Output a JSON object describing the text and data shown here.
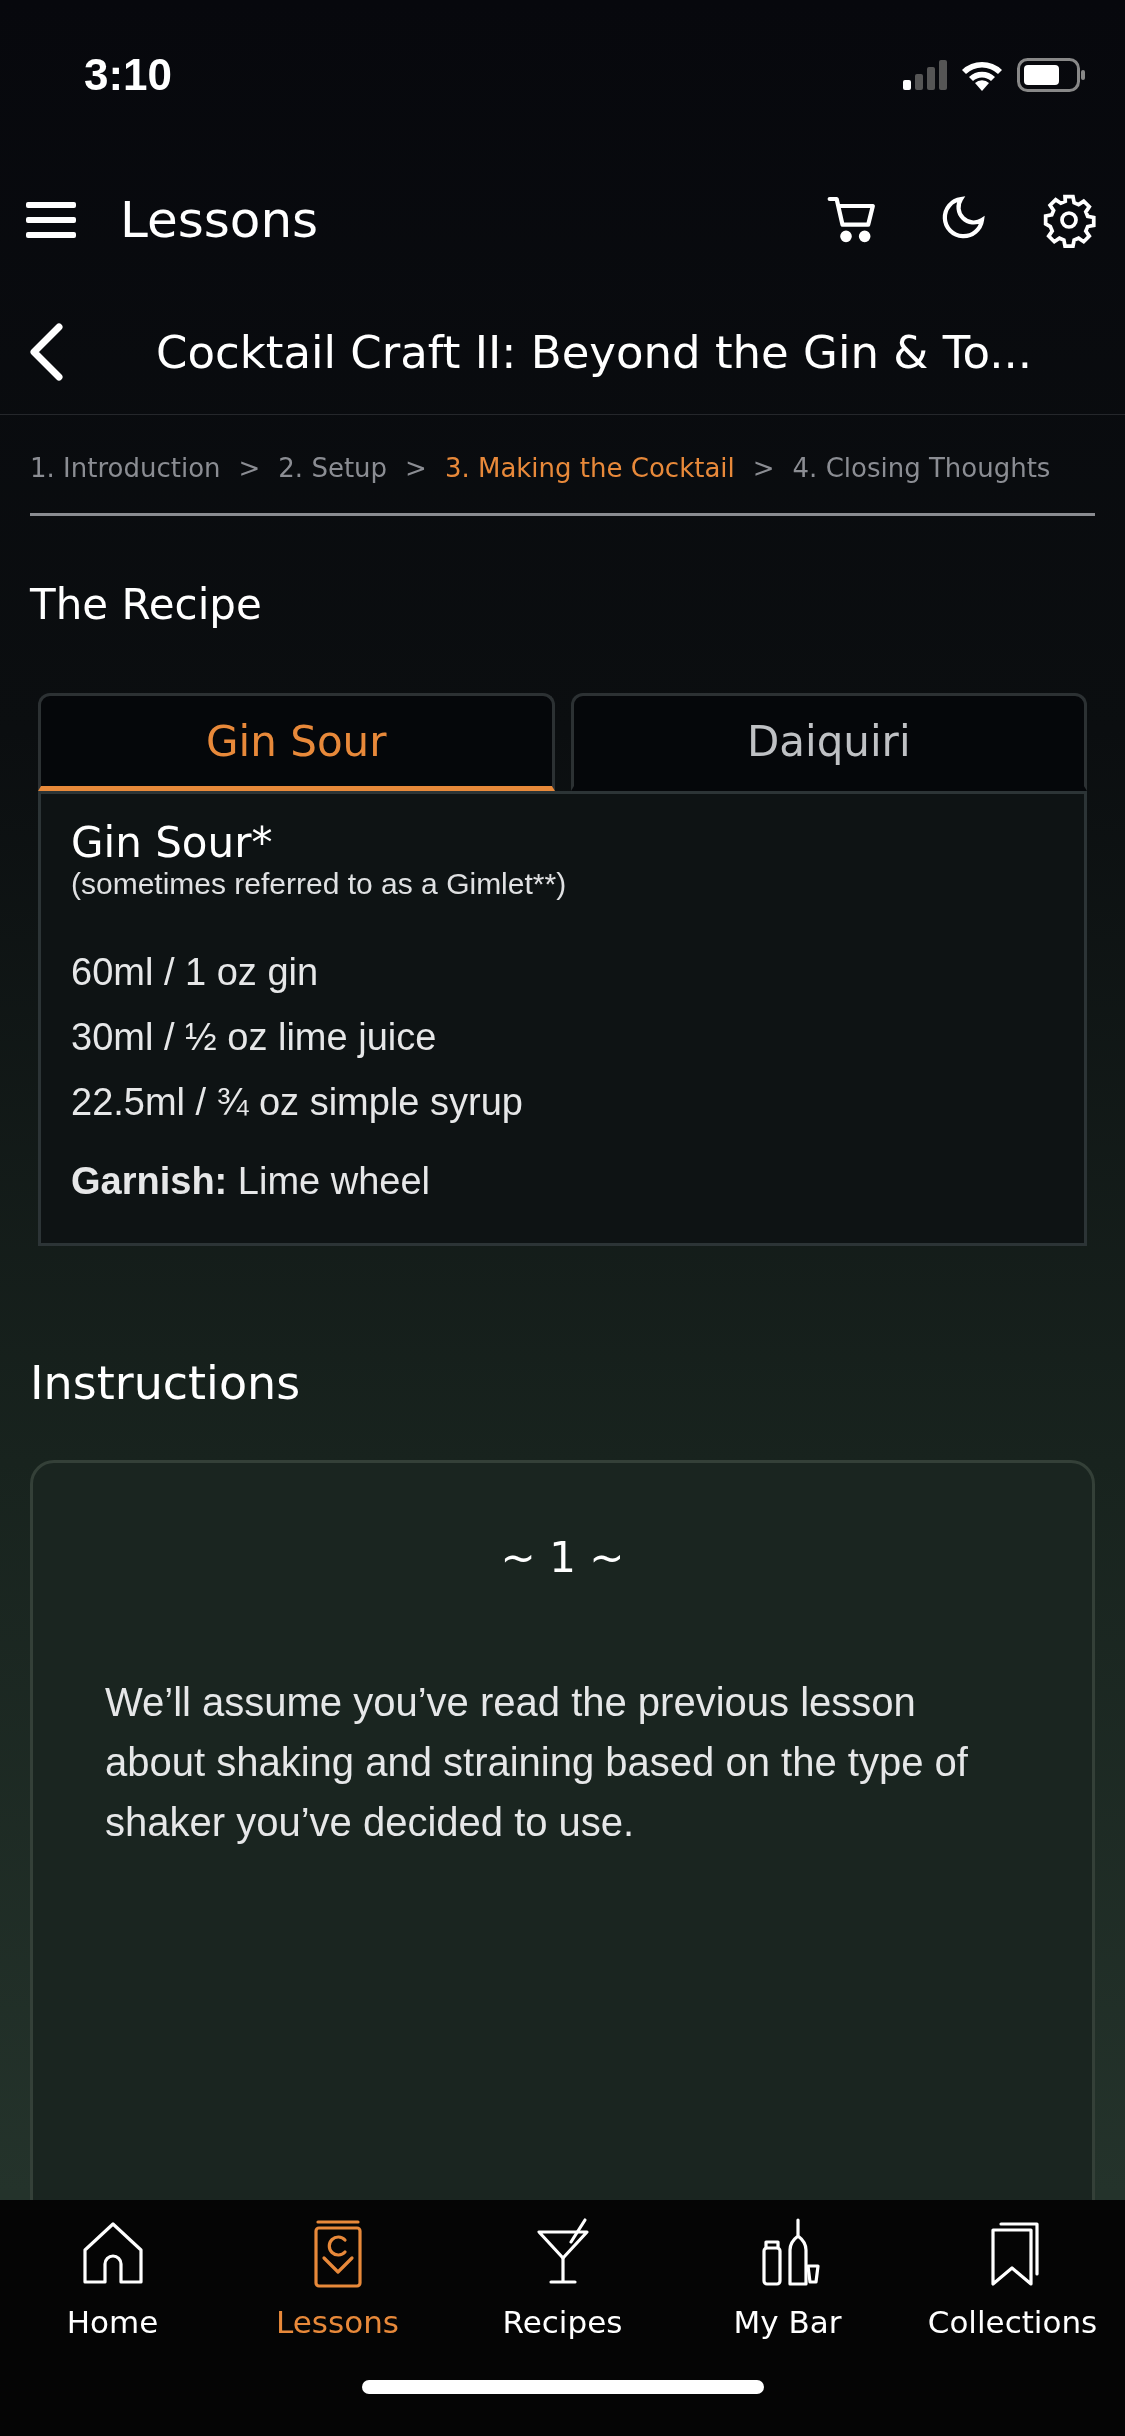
{
  "status_bar": {
    "time": "3:10"
  },
  "header": {
    "title": "Lessons"
  },
  "lesson": {
    "title": "Cocktail Craft II: Beyond the Gin & To..."
  },
  "breadcrumbs": [
    {
      "kind": "step",
      "label": "1. Introduction",
      "selected": false
    },
    {
      "kind": "separator",
      "label": ">"
    },
    {
      "kind": "step",
      "label": "2. Setup",
      "selected": false
    },
    {
      "kind": "separator",
      "label": ">"
    },
    {
      "kind": "step",
      "label": "3. Making the Cocktail",
      "selected": true
    },
    {
      "kind": "separator",
      "label": ">"
    },
    {
      "kind": "step",
      "label": "4. Closing Thoughts",
      "selected": false
    }
  ],
  "recipe": {
    "heading": "The Recipe",
    "tabs": [
      {
        "label": "Gin Sour",
        "selected": true
      },
      {
        "label": "Daiquiri",
        "selected": false
      }
    ],
    "name": "Gin Sour*",
    "subtitle": "(sometimes referred to as a Gimlet**)",
    "ingredients": [
      "60ml / 1 oz gin",
      "30ml / ½ oz lime juice",
      "22.5ml / ¾ oz simple syrup"
    ],
    "garnish": "**Garnish:** Lime wheel"
  },
  "instructions": {
    "heading": "Instructions",
    "step": "~ 1 ~",
    "text": "We’ll assume you’ve read the previous lesson about shaking and straining based on the type of shaker you’ve decided to use."
  },
  "tab_bar": [
    {
      "kind": "home",
      "label": "Home",
      "selected": false
    },
    {
      "kind": "lessons",
      "label": "Lessons",
      "selected": true
    },
    {
      "kind": "recipes",
      "label": "Recipes",
      "selected": false
    },
    {
      "kind": "bar",
      "label": "My Bar",
      "selected": false
    },
    {
      "kind": "collections",
      "label": "Collections",
      "selected": false
    }
  ]
}
